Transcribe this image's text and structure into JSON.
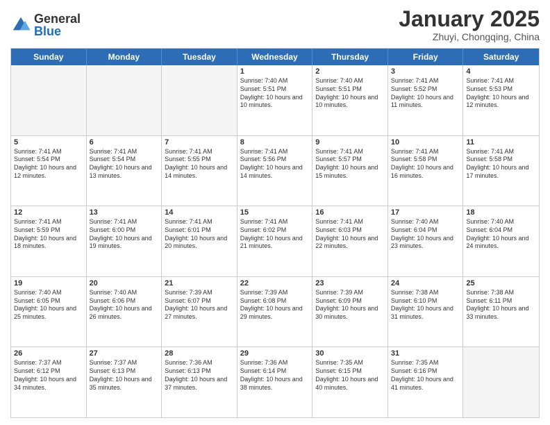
{
  "header": {
    "logo_general": "General",
    "logo_blue": "Blue",
    "month_title": "January 2025",
    "location": "Zhuyi, Chongqing, China"
  },
  "weekdays": [
    "Sunday",
    "Monday",
    "Tuesday",
    "Wednesday",
    "Thursday",
    "Friday",
    "Saturday"
  ],
  "rows": [
    [
      {
        "day": "",
        "text": ""
      },
      {
        "day": "",
        "text": ""
      },
      {
        "day": "",
        "text": ""
      },
      {
        "day": "1",
        "text": "Sunrise: 7:40 AM\nSunset: 5:51 PM\nDaylight: 10 hours and 10 minutes."
      },
      {
        "day": "2",
        "text": "Sunrise: 7:40 AM\nSunset: 5:51 PM\nDaylight: 10 hours and 10 minutes."
      },
      {
        "day": "3",
        "text": "Sunrise: 7:41 AM\nSunset: 5:52 PM\nDaylight: 10 hours and 11 minutes."
      },
      {
        "day": "4",
        "text": "Sunrise: 7:41 AM\nSunset: 5:53 PM\nDaylight: 10 hours and 12 minutes."
      }
    ],
    [
      {
        "day": "5",
        "text": "Sunrise: 7:41 AM\nSunset: 5:54 PM\nDaylight: 10 hours and 12 minutes."
      },
      {
        "day": "6",
        "text": "Sunrise: 7:41 AM\nSunset: 5:54 PM\nDaylight: 10 hours and 13 minutes."
      },
      {
        "day": "7",
        "text": "Sunrise: 7:41 AM\nSunset: 5:55 PM\nDaylight: 10 hours and 14 minutes."
      },
      {
        "day": "8",
        "text": "Sunrise: 7:41 AM\nSunset: 5:56 PM\nDaylight: 10 hours and 14 minutes."
      },
      {
        "day": "9",
        "text": "Sunrise: 7:41 AM\nSunset: 5:57 PM\nDaylight: 10 hours and 15 minutes."
      },
      {
        "day": "10",
        "text": "Sunrise: 7:41 AM\nSunset: 5:58 PM\nDaylight: 10 hours and 16 minutes."
      },
      {
        "day": "11",
        "text": "Sunrise: 7:41 AM\nSunset: 5:58 PM\nDaylight: 10 hours and 17 minutes."
      }
    ],
    [
      {
        "day": "12",
        "text": "Sunrise: 7:41 AM\nSunset: 5:59 PM\nDaylight: 10 hours and 18 minutes."
      },
      {
        "day": "13",
        "text": "Sunrise: 7:41 AM\nSunset: 6:00 PM\nDaylight: 10 hours and 19 minutes."
      },
      {
        "day": "14",
        "text": "Sunrise: 7:41 AM\nSunset: 6:01 PM\nDaylight: 10 hours and 20 minutes."
      },
      {
        "day": "15",
        "text": "Sunrise: 7:41 AM\nSunset: 6:02 PM\nDaylight: 10 hours and 21 minutes."
      },
      {
        "day": "16",
        "text": "Sunrise: 7:41 AM\nSunset: 6:03 PM\nDaylight: 10 hours and 22 minutes."
      },
      {
        "day": "17",
        "text": "Sunrise: 7:40 AM\nSunset: 6:04 PM\nDaylight: 10 hours and 23 minutes."
      },
      {
        "day": "18",
        "text": "Sunrise: 7:40 AM\nSunset: 6:04 PM\nDaylight: 10 hours and 24 minutes."
      }
    ],
    [
      {
        "day": "19",
        "text": "Sunrise: 7:40 AM\nSunset: 6:05 PM\nDaylight: 10 hours and 25 minutes."
      },
      {
        "day": "20",
        "text": "Sunrise: 7:40 AM\nSunset: 6:06 PM\nDaylight: 10 hours and 26 minutes."
      },
      {
        "day": "21",
        "text": "Sunrise: 7:39 AM\nSunset: 6:07 PM\nDaylight: 10 hours and 27 minutes."
      },
      {
        "day": "22",
        "text": "Sunrise: 7:39 AM\nSunset: 6:08 PM\nDaylight: 10 hours and 29 minutes."
      },
      {
        "day": "23",
        "text": "Sunrise: 7:39 AM\nSunset: 6:09 PM\nDaylight: 10 hours and 30 minutes."
      },
      {
        "day": "24",
        "text": "Sunrise: 7:38 AM\nSunset: 6:10 PM\nDaylight: 10 hours and 31 minutes."
      },
      {
        "day": "25",
        "text": "Sunrise: 7:38 AM\nSunset: 6:11 PM\nDaylight: 10 hours and 33 minutes."
      }
    ],
    [
      {
        "day": "26",
        "text": "Sunrise: 7:37 AM\nSunset: 6:12 PM\nDaylight: 10 hours and 34 minutes."
      },
      {
        "day": "27",
        "text": "Sunrise: 7:37 AM\nSunset: 6:13 PM\nDaylight: 10 hours and 35 minutes."
      },
      {
        "day": "28",
        "text": "Sunrise: 7:36 AM\nSunset: 6:13 PM\nDaylight: 10 hours and 37 minutes."
      },
      {
        "day": "29",
        "text": "Sunrise: 7:36 AM\nSunset: 6:14 PM\nDaylight: 10 hours and 38 minutes."
      },
      {
        "day": "30",
        "text": "Sunrise: 7:35 AM\nSunset: 6:15 PM\nDaylight: 10 hours and 40 minutes."
      },
      {
        "day": "31",
        "text": "Sunrise: 7:35 AM\nSunset: 6:16 PM\nDaylight: 10 hours and 41 minutes."
      },
      {
        "day": "",
        "text": ""
      }
    ]
  ]
}
